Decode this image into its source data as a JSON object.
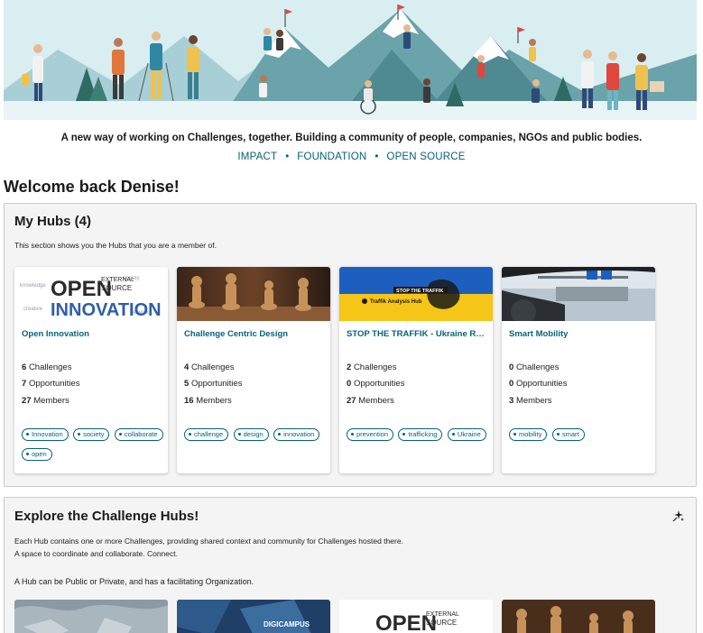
{
  "tagline": "A new way of working on Challenges, together. Building a community of people, companies, NGOs and public bodies.",
  "links": [
    "IMPACT",
    "FOUNDATION",
    "OPEN SOURCE"
  ],
  "welcome": "Welcome back Denise!",
  "my_hubs": {
    "title": "My Hubs (4)",
    "description": "This section shows you the Hubs that you are a member of.",
    "cards": [
      {
        "name": "Open Innovation",
        "image_text": [
          "OPEN",
          "INNOVATION"
        ],
        "challenges": "6",
        "opportunities": "7",
        "members": "27",
        "tags": [
          "Innovation",
          "society",
          "collaborate",
          "open"
        ]
      },
      {
        "name": "Challenge Centric Design",
        "challenges": "4",
        "opportunities": "5",
        "members": "16",
        "tags": [
          "challenge",
          "design",
          "innovation"
        ]
      },
      {
        "name": "STOP THE TRAFFIK - Ukraine Re...",
        "image_text": [
          "STOP THE TRAFFIK",
          "Traffik Analysis Hub"
        ],
        "challenges": "2",
        "opportunities": "0",
        "members": "27",
        "tags": [
          "prevention",
          "trafficking",
          "Ukraine"
        ]
      },
      {
        "name": "Smart Mobility",
        "challenges": "0",
        "opportunities": "0",
        "members": "3",
        "tags": [
          "mobility",
          "smart"
        ]
      }
    ],
    "labels": {
      "challenges": "Challenges",
      "opportunities": "Opportunities",
      "members": "Members"
    }
  },
  "explore": {
    "title": "Explore the Challenge Hubs!",
    "description_line1": "Each Hub contains one or more Challenges, providing shared context and community for Challenges hosted there.",
    "description_line2": "A space to coordinate and collaborate. Connect.",
    "description_line3": "A Hub can be Public or Private, and has a facilitating Organization.",
    "preview_text": [
      "OPEN",
      "DIGICAMPUS"
    ]
  },
  "icons": {
    "filter": "sparkle-icon"
  },
  "colors": {
    "accent": "#06627a",
    "section_bg": "#f4f4f4",
    "ukraine_blue": "#1d5fbf",
    "ukraine_yellow": "#f5c518"
  }
}
